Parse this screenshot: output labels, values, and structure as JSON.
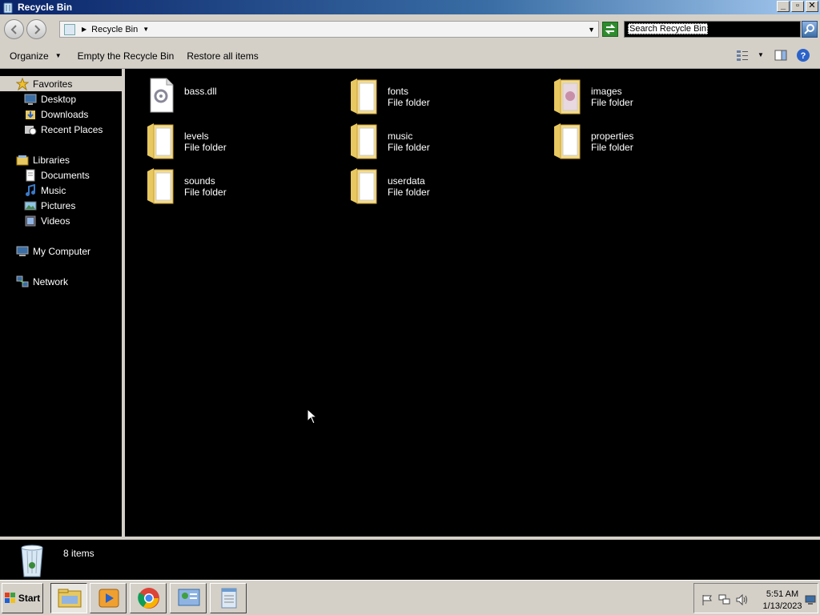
{
  "window": {
    "title": "Recycle Bin",
    "controls": [
      "minimize",
      "restore",
      "close"
    ]
  },
  "address": {
    "path": "Recycle Bin",
    "search_placeholder": "Search Recycle Bin"
  },
  "toolbar": {
    "organize_label": "Organize",
    "empty_label": "Empty the Recycle Bin",
    "restore_label": "Restore all items"
  },
  "sidebar": {
    "favorites": {
      "label": "Favorites",
      "items": [
        {
          "label": "Desktop"
        },
        {
          "label": "Downloads"
        },
        {
          "label": "Recent Places"
        }
      ]
    },
    "libraries": {
      "label": "Libraries",
      "items": [
        {
          "label": "Documents"
        },
        {
          "label": "Music"
        },
        {
          "label": "Pictures"
        },
        {
          "label": "Videos"
        }
      ]
    },
    "computer": {
      "label": "My Computer"
    },
    "network": {
      "label": "Network"
    }
  },
  "files": [
    {
      "name": "bass.dll",
      "type": "",
      "icon": "dll-file-icon"
    },
    {
      "name": "fonts",
      "type": "File folder",
      "icon": "folder-icon"
    },
    {
      "name": "images",
      "type": "File folder",
      "icon": "folder-images-icon"
    },
    {
      "name": "levels",
      "type": "File folder",
      "icon": "folder-icon"
    },
    {
      "name": "music",
      "type": "File folder",
      "icon": "folder-icon"
    },
    {
      "name": "properties",
      "type": "File folder",
      "icon": "folder-icon"
    },
    {
      "name": "sounds",
      "type": "File folder",
      "icon": "folder-icon"
    },
    {
      "name": "userdata",
      "type": "File folder",
      "icon": "folder-icon"
    }
  ],
  "details": {
    "count": "8 items"
  },
  "taskbar": {
    "start_label": "Start",
    "apps": [
      "windows-explorer",
      "media-player",
      "chrome",
      "control-panel",
      "notepad"
    ],
    "clock": {
      "time": "5:51 AM",
      "date": "1/13/2023"
    }
  }
}
